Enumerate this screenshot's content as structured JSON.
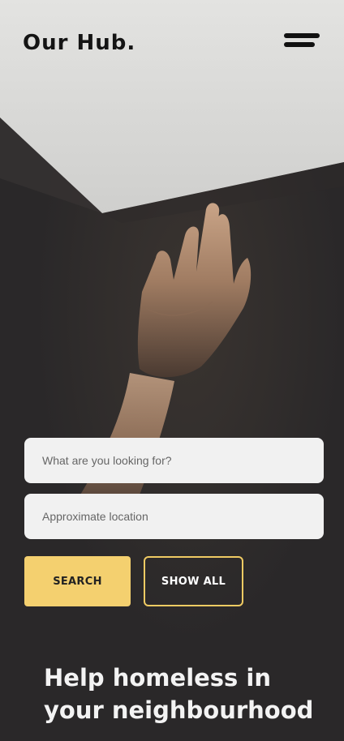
{
  "header": {
    "logo": "Our Hub.",
    "menu_icon": "hamburger-menu-icon"
  },
  "search": {
    "query_placeholder": "What are you looking for?",
    "location_placeholder": "Approximate location",
    "search_label": "SEARCH",
    "show_all_label": "SHOW ALL"
  },
  "hero": {
    "image": "reaching-hand-photo"
  },
  "section": {
    "headline": "Help homeless in your neighbourhood"
  },
  "colors": {
    "accent": "#f4d06f",
    "background": "#2a2829",
    "field_bg": "#f1f1f1"
  }
}
